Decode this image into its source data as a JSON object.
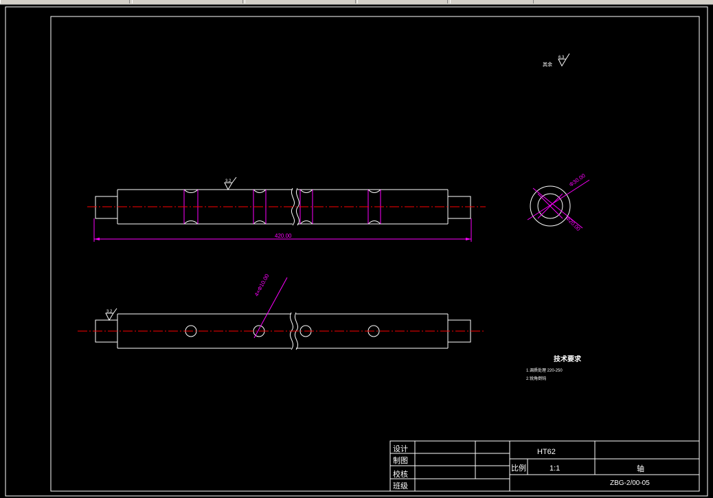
{
  "colors": {
    "background": "#000000",
    "outline": "#ffffff",
    "dimension": "#ff00ff",
    "centerline": "#ff0000"
  },
  "annotations": {
    "roughness_note_prefix": "其余",
    "roughness_note_value": "6.3",
    "top_roughness": "3.2",
    "front_roughness": "3.2",
    "length_dimension": "420.00",
    "hole_dimension": "4×Φ10.00",
    "outer_diameter": "Φ30.00",
    "inner_diameter": "Φ20.00"
  },
  "tech_requirements": {
    "title": "技术要求",
    "items": [
      "1.调质处理 220-250",
      "2.锐角倒钝"
    ]
  },
  "title_block": {
    "label_design": "设计",
    "label_draw": "制图",
    "label_check": "校核",
    "label_class": "班级",
    "material": "HT62",
    "label_scale": "比例",
    "scale_value": "1:1",
    "part_name": "轴",
    "drawing_number": "ZBG-2/00-05"
  }
}
